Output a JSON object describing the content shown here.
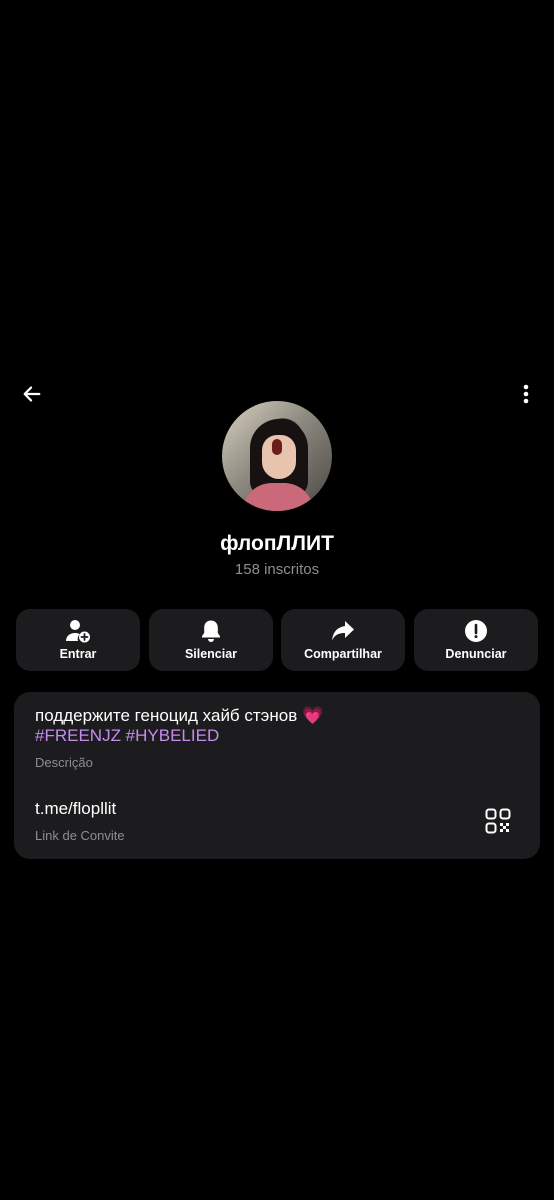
{
  "header": {
    "back_icon": "arrow-left-icon",
    "menu_icon": "more-vertical-icon"
  },
  "channel": {
    "name": "флопЛЛИТ",
    "subscribers": "158 inscritos"
  },
  "actions": [
    {
      "label": "Entrar",
      "icon": "add-user-icon"
    },
    {
      "label": "Silenciar",
      "icon": "bell-icon"
    },
    {
      "label": "Compartilhar",
      "icon": "share-icon"
    },
    {
      "label": "Denunciar",
      "icon": "report-icon"
    }
  ],
  "info": {
    "description_line1": "поддержите геноцид хайб стэнов 💗",
    "description_line2": "#FREENJZ #HYBELIED",
    "description_label": "Descrição",
    "link": "t.me/flopllit",
    "link_label": "Link de Convite"
  },
  "colors": {
    "background": "#000000",
    "card": "#1c1c1e",
    "hashtag": "#c58cf0",
    "secondary_text": "#8e8e93"
  }
}
